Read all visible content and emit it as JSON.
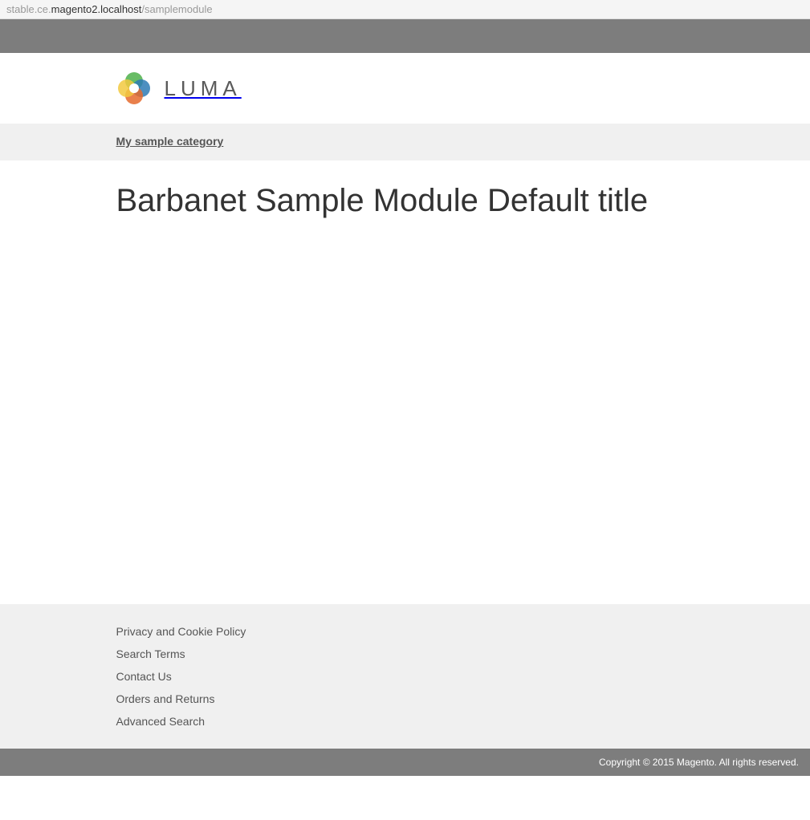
{
  "url": {
    "prefix": "stable.ce.",
    "host": "magento2.localhost",
    "path": "/samplemodule"
  },
  "logo": {
    "text": "LUMA"
  },
  "nav": {
    "items": [
      {
        "label": "My sample category"
      }
    ]
  },
  "page": {
    "title": "Barbanet Sample Module Default title"
  },
  "footer": {
    "links": [
      {
        "label": "Privacy and Cookie Policy"
      },
      {
        "label": "Search Terms"
      },
      {
        "label": "Contact Us"
      },
      {
        "label": "Orders and Returns"
      },
      {
        "label": "Advanced Search"
      }
    ],
    "copyright": "Copyright © 2015 Magento. All rights reserved."
  }
}
